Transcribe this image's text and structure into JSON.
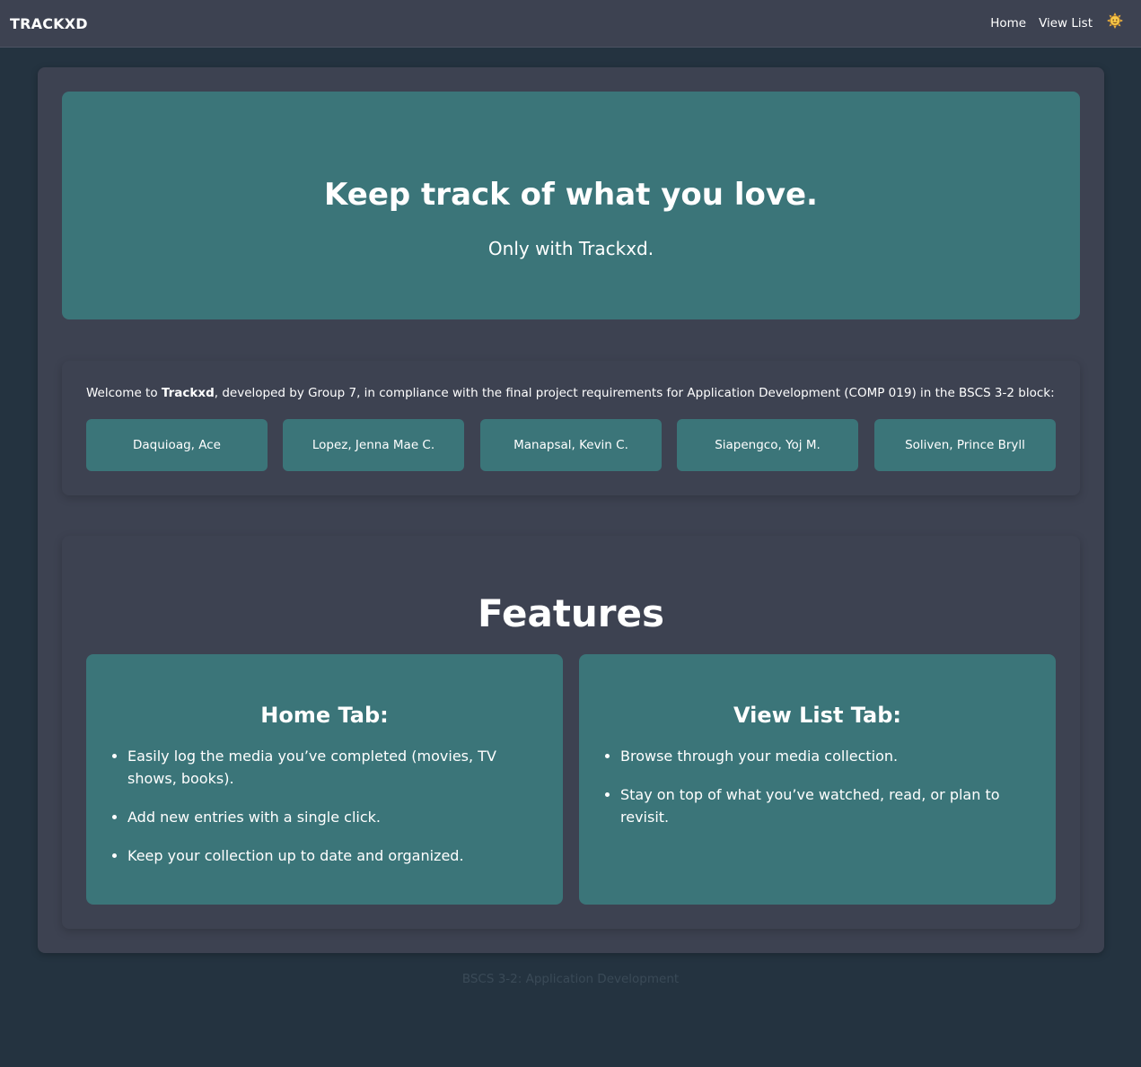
{
  "navbar": {
    "brand": "TRACKXD",
    "links": [
      "Home",
      "View List"
    ],
    "theme_icon": "sun-face-icon"
  },
  "hero": {
    "title": "Keep track of what you love.",
    "subtitle": "Only with Trackxd."
  },
  "welcome": {
    "prefix": "Welcome to ",
    "app_name": "Trackxd",
    "suffix": ", developed by Group 7, in compliance with the final project requirements for Application Development (COMP 019) in the BSCS 3-2 block:",
    "members": [
      "Daquioag, Ace",
      "Lopez, Jenna Mae C.",
      "Manapsal, Kevin C.",
      "Siapengco, Yoj M.",
      "Soliven, Prince Bryll"
    ]
  },
  "features": {
    "title": "Features",
    "cards": [
      {
        "title": "Home Tab:",
        "items": [
          "Easily log the media you’ve completed (movies, TV shows, books).",
          "Add new entries with a single click.",
          "Keep your collection up to date and organized."
        ]
      },
      {
        "title": "View List Tab:",
        "items": [
          "Browse through your media collection.",
          "Stay on top of what you’ve watched, read, or plan to revisit."
        ]
      }
    ]
  },
  "footer": {
    "text": "BSCS 3-2: Application Development"
  },
  "colors": {
    "page_bg": "#243340",
    "panel_bg": "#3d4251",
    "accent_teal": "#3b7579",
    "footer_text": "#3a4a57"
  }
}
